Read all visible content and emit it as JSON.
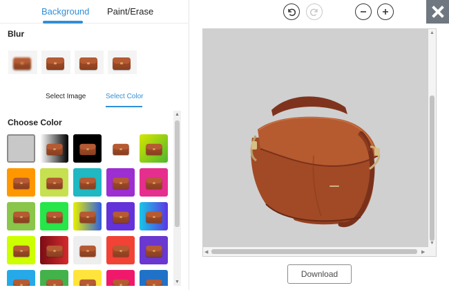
{
  "tabs": {
    "background": "Background",
    "paint_erase": "Paint/Erase"
  },
  "blur": {
    "title": "Blur",
    "thumb_count": 4
  },
  "sub_tabs": {
    "select_image": "Select Image",
    "select_color": "Select Color"
  },
  "choose_color": {
    "title": "Choose Color"
  },
  "swatches": [
    [
      "#c8c8c8",
      "linear-gradient(90deg,#ffffff,#000000)",
      "#000000",
      "#ffffff",
      "linear-gradient(135deg,#d7e600,#4db82c)"
    ],
    [
      "#ff9800",
      "#c6e04f",
      "#20b8c3",
      "#9d2ed2",
      "#e62e8f"
    ],
    [
      "#89c64a",
      "#26e64a",
      "linear-gradient(90deg,#e8f000,#2f5de3)",
      "#6432d9",
      "linear-gradient(90deg,#17c6e8,#5d35e3)"
    ],
    [
      "#ccff00",
      "linear-gradient(90deg,#7a0d14,#d42a2d)",
      "#eeeeee",
      "#f24236",
      "#6a37d0"
    ],
    [
      "#26a9e8",
      "#43b24b",
      "#ffe53b",
      "#f0186a",
      "#1f72c8"
    ]
  ],
  "toolbar": {
    "undo": "undo",
    "redo": "redo",
    "zoom_out": "zoom-out",
    "zoom_in": "zoom-in",
    "close": "close"
  },
  "canvas": {
    "background": "#d0d0d0"
  },
  "download": "Download",
  "colors": {
    "accent": "#2f8fd8",
    "close_bg": "#6f7880",
    "bag": "#9c4826"
  }
}
